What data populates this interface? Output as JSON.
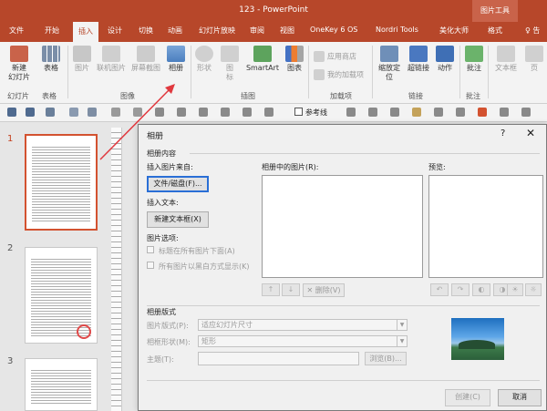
{
  "titlebar": {
    "title": "123 - PowerPoint",
    "context_tab": "图片工具"
  },
  "tabs": [
    {
      "label": "文件"
    },
    {
      "label": "开始"
    },
    {
      "label": "插入"
    },
    {
      "label": "设计"
    },
    {
      "label": "切换"
    },
    {
      "label": "动画"
    },
    {
      "label": "幻灯片放映"
    },
    {
      "label": "审阅"
    },
    {
      "label": "视图"
    },
    {
      "label": "OneKey 6 OS"
    },
    {
      "label": "Nordri Tools"
    },
    {
      "label": "美化大师"
    },
    {
      "label": "格式"
    }
  ],
  "tell_me": "♀ 告",
  "ribbon": {
    "buttons": {
      "new_slide": "新建",
      "new_slide2": "幻灯片",
      "table": "表格",
      "image": "图片",
      "online_image": "联机图片",
      "screenshot": "屏幕截图",
      "album": "相册",
      "shapes": "形状",
      "icons": "图",
      "icons2": "标",
      "smartart": "SmartArt",
      "chart": "图表",
      "store": "应用商店",
      "my_addins": "我的加载项",
      "zoom": "缩放定",
      "zoom2": "位",
      "hyperlink": "超链接",
      "action": "动作",
      "comment": "批注",
      "textbox": "文本框",
      "header_footer": "页"
    },
    "groups": {
      "slides": "幻灯片",
      "tables": "表格",
      "images": "图像",
      "illustrations": "插图",
      "addins": "加载项",
      "links": "链接",
      "comments": "批注"
    }
  },
  "qat": {
    "reference_lines": "参考线"
  },
  "thumbnails": [
    {
      "number": "1"
    },
    {
      "number": "2"
    },
    {
      "number": "3"
    }
  ],
  "dialog": {
    "title": "相册",
    "help": "?",
    "close": "✕",
    "album_content": "相册内容",
    "insert_from": "插入图片来自:",
    "file_disk_button": "文件/磁盘(F)...",
    "insert_text": "插入文本:",
    "new_textbox_button": "新建文本框(X)",
    "picture_options": "图片选项:",
    "caption_below": "标题在所有图片下面(A)",
    "all_bw": "所有图片以黑白方式显示(K)",
    "pictures_in_album": "相册中的图片(R):",
    "preview": "预览:",
    "delete_button": "删除(V)",
    "album_layout": "相册版式",
    "picture_layout_label": "图片版式(P):",
    "picture_layout_value": "适应幻灯片尺寸",
    "frame_shape_label": "相框形状(M):",
    "frame_shape_value": "矩形",
    "theme_label": "主题(T):",
    "browse_button": "浏览(B)...",
    "create_button": "创建(C)",
    "cancel_button": "取消"
  },
  "colors": {
    "accent": "#b7472a",
    "highlight": "#d35230",
    "arrow": "#e0383e",
    "focus": "#2a6fd6"
  }
}
